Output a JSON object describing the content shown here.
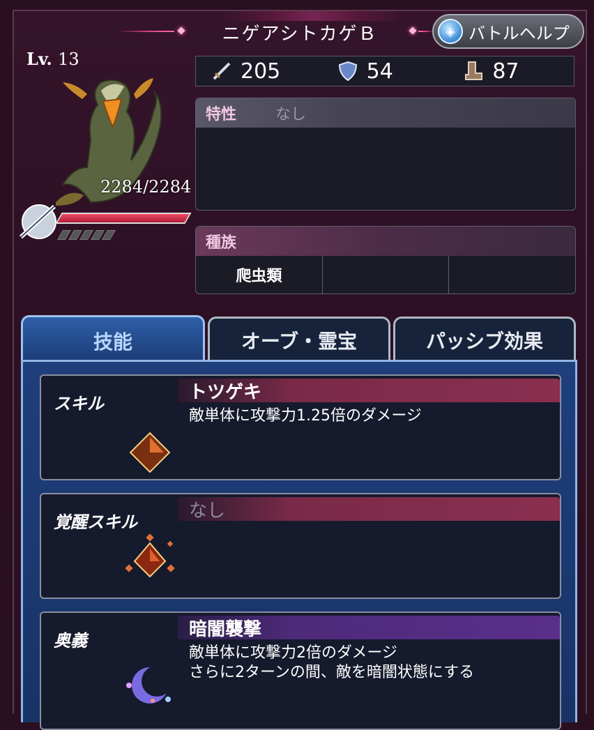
{
  "header": {
    "title": "ニゲアシトカゲＢ",
    "help_button": "バトルヘルプ"
  },
  "unit": {
    "level_prefix": "Lv.",
    "level": "13",
    "hp": "2284/2284",
    "hp_fill": 1.0
  },
  "stats": {
    "attack": "205",
    "defense": "54",
    "speed": "87"
  },
  "trait": {
    "label": "特性",
    "value": "なし"
  },
  "race": {
    "label": "種族",
    "cells": [
      "爬虫類",
      "",
      ""
    ]
  },
  "tabs": [
    {
      "label": "技能",
      "active": true
    },
    {
      "label": "オーブ・霊宝",
      "active": false
    },
    {
      "label": "パッシブ効果",
      "active": false
    }
  ],
  "skills": [
    {
      "type": "スキル",
      "name": "トツゲキ",
      "desc": "敵単体に攻撃力1.25倍のダメージ"
    },
    {
      "type": "覚醒スキル",
      "name": "なし",
      "desc": ""
    },
    {
      "type": "奥義",
      "name": "暗闇襲撃",
      "desc": "敵単体に攻撃力2倍のダメージ\nさらに2ターンの間、敵を暗闇状態にする"
    }
  ],
  "colors": {
    "background": "#2a0f20",
    "hp_bar": "#e03a55",
    "tab_active": "#2e5fa8",
    "skill_bar": "#8a2f4f",
    "ougi_bar": "#5a2f8a"
  }
}
